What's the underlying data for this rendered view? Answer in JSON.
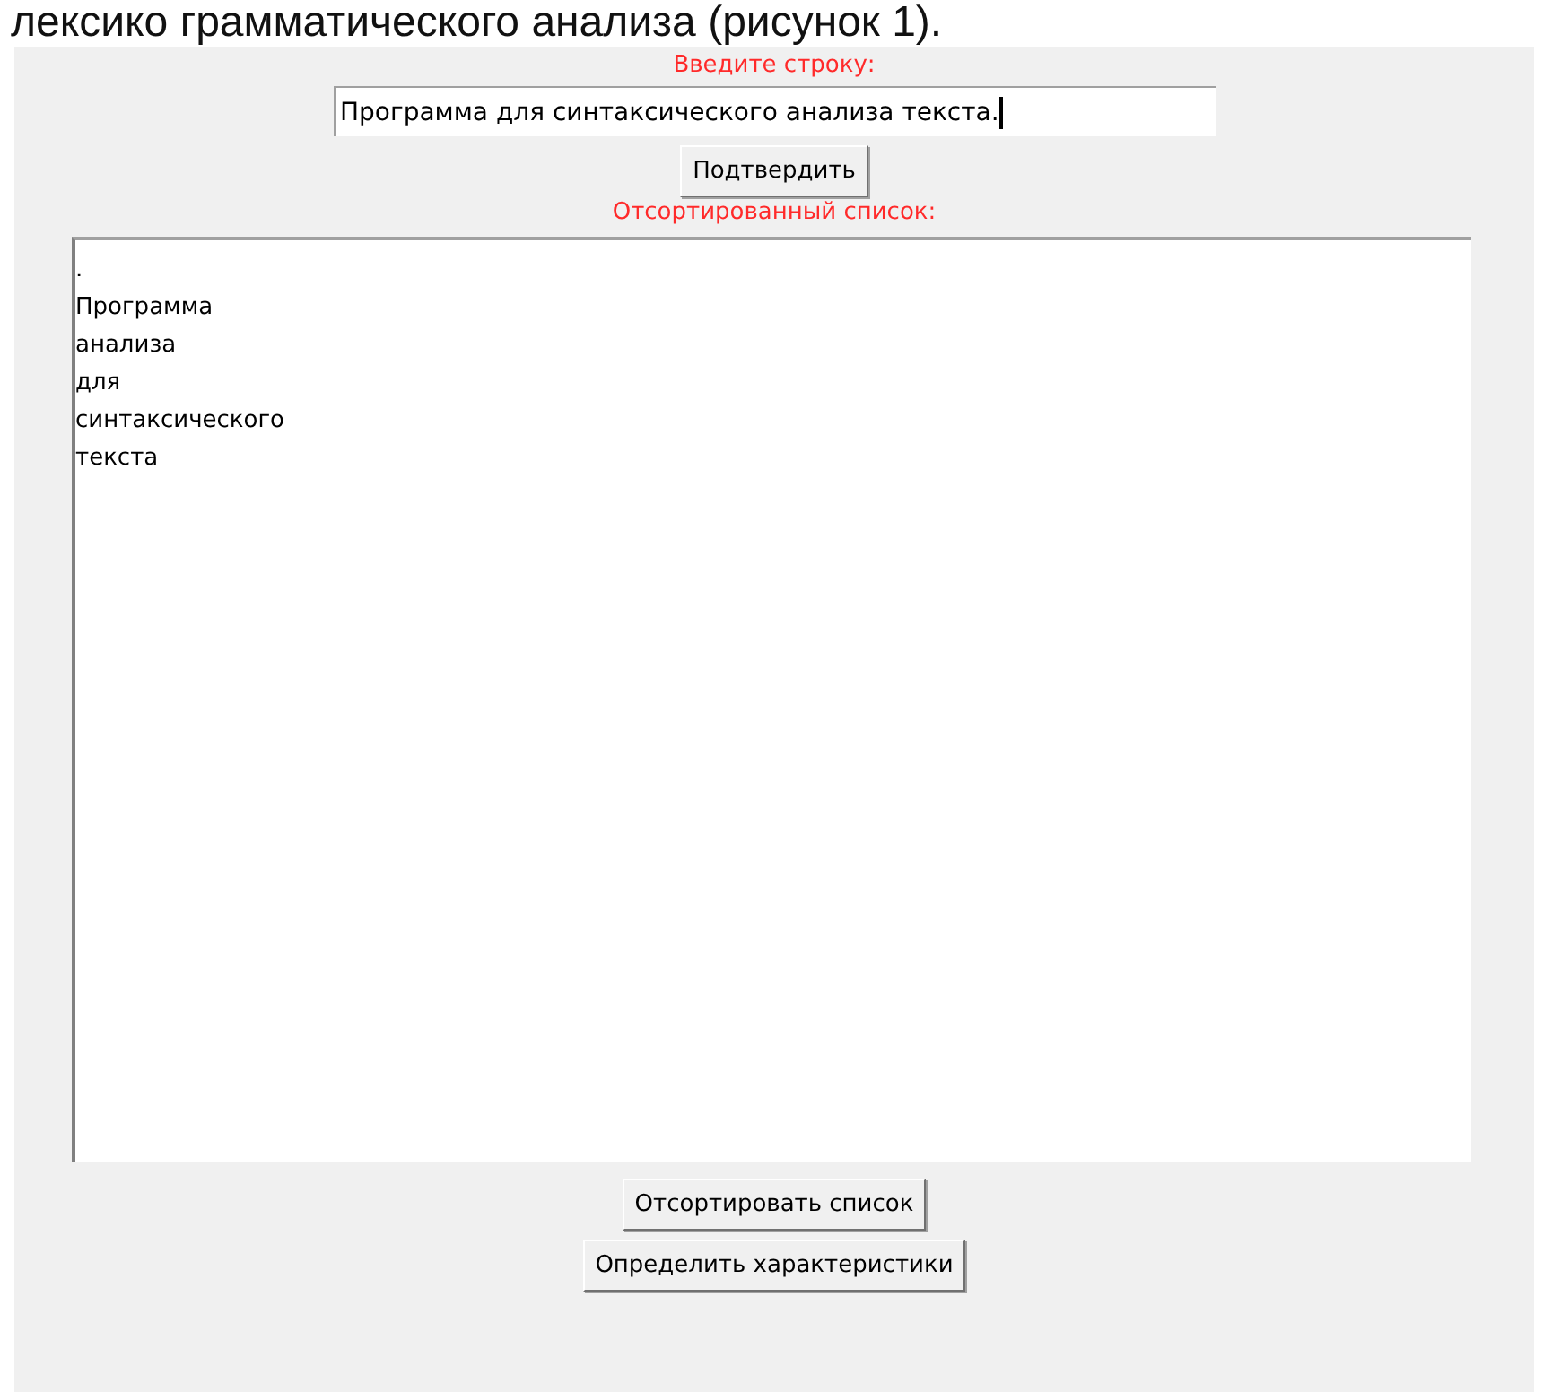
{
  "document_caption": "лексико грамматического анализа (рисунок 1).",
  "window": {
    "input_label": "Введите строку:",
    "input": {
      "value": "Программа для синтаксического анализа текста."
    },
    "confirm_button": "Подтвердить",
    "list_label": "Отсортированный список:",
    "list_items": [
      ".",
      "Программа",
      "анализа",
      "для",
      "синтаксического",
      "текста"
    ],
    "buttons": [
      "Отсортировать список",
      "Определить характеристики"
    ]
  }
}
